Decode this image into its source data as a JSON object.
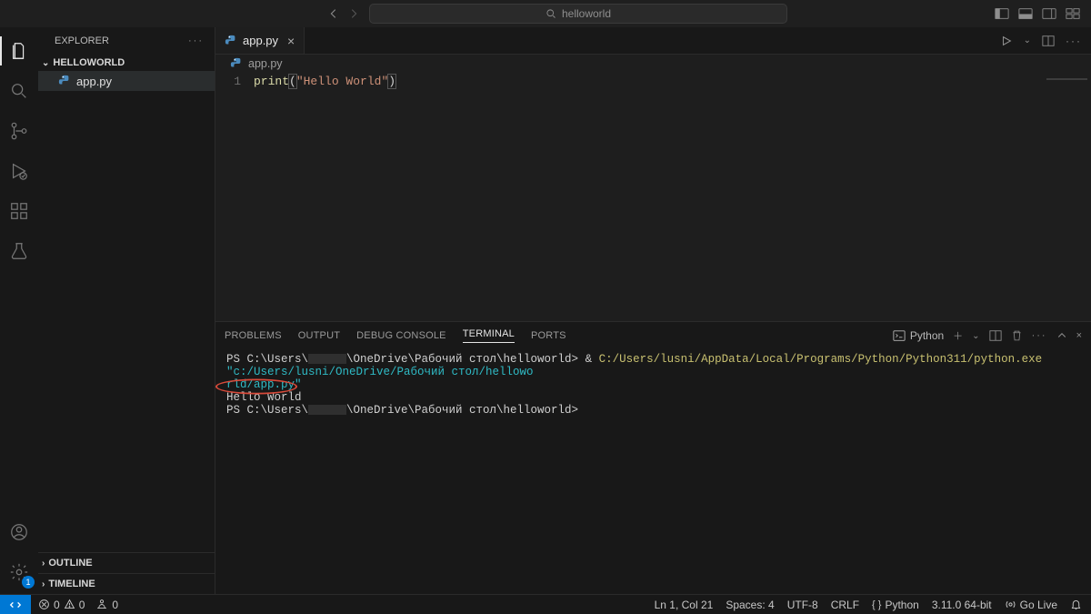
{
  "title": {
    "search_text": "helloworld"
  },
  "sidebar": {
    "title": "EXPLORER",
    "folder": "HELLOWORLD",
    "file": "app.py",
    "outline": "OUTLINE",
    "timeline": "TIMELINE"
  },
  "tab": {
    "filename": "app.py"
  },
  "breadcrumb": {
    "file": "app.py"
  },
  "editor": {
    "line_no": "1",
    "code_fn": "print",
    "code_lp": "(",
    "code_str": "\"Hello World\"",
    "code_rp": ")"
  },
  "panel": {
    "tabs": {
      "problems": "PROBLEMS",
      "output": "OUTPUT",
      "debug_console": "DEBUG CONSOLE",
      "terminal": "TERMINAL",
      "ports": "PORTS"
    },
    "shell_label": "Python"
  },
  "terminal": {
    "prompt_prefix": "PS C:\\Users\\",
    "prompt_path": "\\OneDrive\\Рабочий стол\\helloworld>",
    "amp": " & ",
    "exe_path": "C:/Users/lusni/AppData/Local/Programs/Python/Python311/python.exe",
    "arg_frag1": "\"c:/Users/lusni/OneDrive/Рабочий стол/hellowo",
    "arg_frag2": "rld/app.py\"",
    "output_line": "Hello World",
    "prompt2_prefix": "PS C:\\Users\\",
    "prompt2_path": "\\OneDrive\\Рабочий стол\\helloworld>"
  },
  "status": {
    "errors": "0",
    "warnings": "0",
    "ports": "0",
    "ln_col": "Ln 1, Col 21",
    "spaces": "Spaces: 4",
    "encoding": "UTF-8",
    "eol": "CRLF",
    "language": "Python",
    "interpreter": "3.11.0 64-bit",
    "golive": "Go Live"
  },
  "settings_badge": "1"
}
